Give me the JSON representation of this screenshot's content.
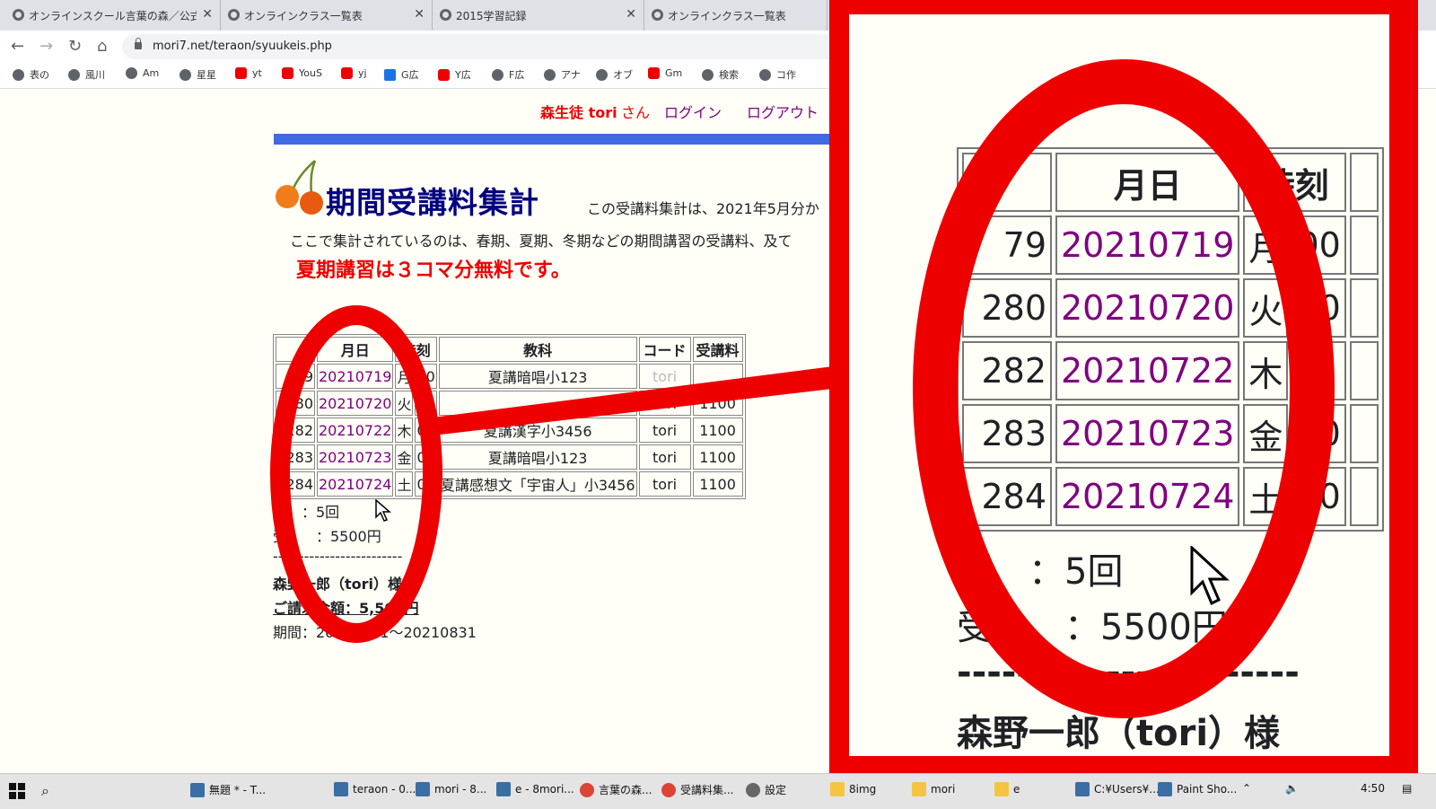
{
  "browser": {
    "tabs": [
      {
        "label": "オンラインスクール言葉の森／公式ホ"
      },
      {
        "label": "オンラインクラス一覧表"
      },
      {
        "label": "2015学習記録"
      },
      {
        "label": "オンラインクラス一覧表"
      }
    ],
    "url": "mori7.net/teraon/syuukeis.php",
    "bookmarks": [
      "表の",
      "風川",
      "Am",
      "星星",
      "yt",
      "YouS",
      "yj",
      "G広",
      "Y広",
      "F広",
      "アナ",
      "オブ",
      "Gm",
      "検索",
      "コ作"
    ]
  },
  "header": {
    "user_name": "森生徒 tori",
    "user_suffix": "さん",
    "login": "ログイン",
    "logout": "ログアウト"
  },
  "page": {
    "title": "期間受講料集計",
    "note_right": "この受講料集計は、2021年5月分か",
    "description": "ここで集計されているのは、春期、夏期、冬期などの期間講習の受講料、及て",
    "free_notice": "夏期講習は３コマ分無料です。"
  },
  "table": {
    "headers": [
      "",
      "月日",
      "時刻",
      "教科",
      "コード",
      "受講料"
    ],
    "rows": [
      [
        "79",
        "20210719",
        "月",
        "00",
        "夏講暗唱小123",
        "tori",
        ""
      ],
      [
        "280",
        "20210720",
        "火",
        "00",
        "",
        "tori",
        "1100"
      ],
      [
        "282",
        "20210722",
        "木",
        "0",
        "夏講漢字小3456",
        "tori",
        "1100"
      ],
      [
        "283",
        "20210723",
        "金",
        "0",
        "夏講暗唱小123",
        "tori",
        "1100"
      ],
      [
        "284",
        "20210724",
        "土",
        "00",
        "夏講感想文「宇宙人」小3456",
        "tori",
        "1100"
      ]
    ]
  },
  "summary": {
    "count": "回　：5回",
    "fee": "受　　：5500円",
    "divider": "-------------------------",
    "customer": "森野一郎（tori）様",
    "bill": "ご請求金額：5,500円",
    "period": "期間：20210701～20210831"
  },
  "zoom": {
    "headers": [
      "",
      "月日",
      "時刻",
      ""
    ],
    "rows": [
      [
        "79",
        "20210719",
        "月",
        "00"
      ],
      [
        "280",
        "20210720",
        "火",
        "00"
      ],
      [
        "282",
        "20210722",
        "木",
        "0"
      ],
      [
        "283",
        "20210723",
        "金",
        "00"
      ],
      [
        "284",
        "20210724",
        "土",
        "00"
      ]
    ],
    "count": "回　：5回",
    "fee": "受　　：5500円",
    "divider": "-----------------------",
    "customer": "森野一郎（tori）様"
  },
  "taskbar": {
    "items": [
      "無題 * - T...",
      "teraon - 0...",
      "mori - 8...",
      "e - 8mori...",
      "言葉の森...",
      "受講料集...",
      "設定",
      "8img",
      "mori",
      "e",
      "C:¥Users¥...",
      "Paint Sho..."
    ],
    "clock": "4:50"
  },
  "colors": {
    "annotation": "#ee0000",
    "link": "#800080",
    "title": "#000080",
    "bar": "#4169e1"
  }
}
